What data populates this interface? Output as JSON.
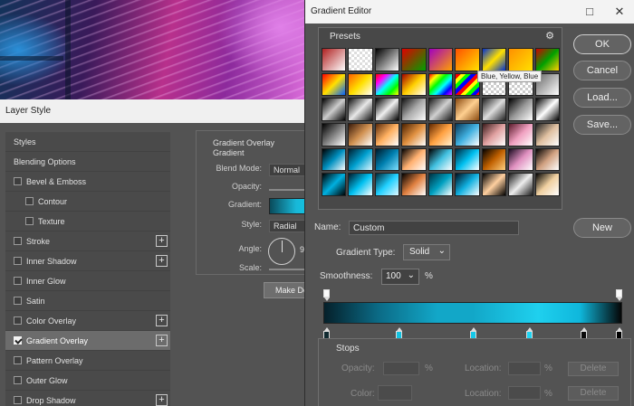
{
  "layer_style": {
    "title": "Layer Style",
    "items": [
      {
        "label": "Styles",
        "checkbox": false,
        "checked": false,
        "indent": false,
        "plus": false,
        "selected": false
      },
      {
        "label": "Blending Options",
        "checkbox": false,
        "checked": false,
        "indent": false,
        "plus": false,
        "selected": false
      },
      {
        "label": "Bevel & Emboss",
        "checkbox": true,
        "checked": false,
        "indent": false,
        "plus": false,
        "selected": false
      },
      {
        "label": "Contour",
        "checkbox": true,
        "checked": false,
        "indent": true,
        "plus": false,
        "selected": false
      },
      {
        "label": "Texture",
        "checkbox": true,
        "checked": false,
        "indent": true,
        "plus": false,
        "selected": false
      },
      {
        "label": "Stroke",
        "checkbox": true,
        "checked": false,
        "indent": false,
        "plus": true,
        "selected": false
      },
      {
        "label": "Inner Shadow",
        "checkbox": true,
        "checked": false,
        "indent": false,
        "plus": true,
        "selected": false
      },
      {
        "label": "Inner Glow",
        "checkbox": true,
        "checked": false,
        "indent": false,
        "plus": false,
        "selected": false
      },
      {
        "label": "Satin",
        "checkbox": true,
        "checked": false,
        "indent": false,
        "plus": false,
        "selected": false
      },
      {
        "label": "Color Overlay",
        "checkbox": true,
        "checked": false,
        "indent": false,
        "plus": true,
        "selected": false
      },
      {
        "label": "Gradient Overlay",
        "checkbox": true,
        "checked": true,
        "indent": false,
        "plus": true,
        "selected": true
      },
      {
        "label": "Pattern Overlay",
        "checkbox": true,
        "checked": false,
        "indent": false,
        "plus": false,
        "selected": false
      },
      {
        "label": "Outer Glow",
        "checkbox": true,
        "checked": false,
        "indent": false,
        "plus": false,
        "selected": false
      },
      {
        "label": "Drop Shadow",
        "checkbox": true,
        "checked": false,
        "indent": false,
        "plus": true,
        "selected": false
      }
    ],
    "panel": {
      "title": "Gradient Overlay",
      "subtitle": "Gradient",
      "blend_mode_label": "Blend Mode:",
      "blend_mode_value": "Normal",
      "opacity_label": "Opacity:",
      "gradient_label": "Gradient:",
      "style_label": "Style:",
      "style_value": "Radial",
      "angle_label": "Angle:",
      "angle_value": "9",
      "scale_label": "Scale:",
      "make_default_label": "Make De"
    }
  },
  "gradient_editor": {
    "title": "Gradient Editor",
    "window_buttons": {
      "minimize": "□",
      "close": "✕"
    },
    "presets": {
      "title": "Presets",
      "gear_icon": "⚙",
      "tooltip": "Blue, Yellow, Blue",
      "swatches": [
        "linear-gradient(135deg,#b02020,#fff)",
        "repeating-conic-gradient(#ddd 0 25%,#fff 0 50%) 0 0/6px 6px",
        "linear-gradient(135deg,#000,#fff)",
        "linear-gradient(135deg,#e00000,#00a000)",
        "linear-gradient(135deg,#a000c0,#ffa000)",
        "linear-gradient(135deg,#ff5000,#ffe000)",
        "linear-gradient(135deg,#0030d0,#ffe000,#0030d0)",
        "linear-gradient(135deg,#ff9000,#ffe000)",
        "linear-gradient(135deg,#d00000,#00a000,#ffd000)",
        "linear-gradient(135deg,#ff0000,#ffe000,#0060ff)",
        "linear-gradient(135deg,#ff6000,#ffe000,#fff)",
        "linear-gradient(135deg,#ff0000,#ff00ff,#00ffff,#00ff00,#ffff00)",
        "linear-gradient(135deg,#a00000,#ffd000,#fff)",
        "linear-gradient(135deg,#ff0000,#ffff00,#00ff00,#00ffff,#0000ff,#ff00ff)",
        "repeating-linear-gradient(135deg,#ff0000 0 4px,#ffff00 4px 8px,#00ff00 8px 12px,#0000ff 12px 16px)",
        "repeating-conic-gradient(#ccc 0 25%,#fff 0 50%) 0 0/6px 6px",
        "repeating-conic-gradient(#ccc 0 25%,#fff 0 50%) 0 0/6px 6px",
        "linear-gradient(135deg,#666,#fff)",
        "linear-gradient(135deg,#000,#ccc,#000)",
        "linear-gradient(135deg,#111,#e8e8e8,#111)",
        "linear-gradient(135deg,#000,#f0f0f0,#000)",
        "linear-gradient(135deg,#111,#aaa,#fff)",
        "linear-gradient(135deg,#1a1a1a,#d0d0d0,#1a1a1a)",
        "linear-gradient(135deg,#8a4a10,#ffd090,#8a4a10)",
        "linear-gradient(135deg,#222,#ddd,#222)",
        "linear-gradient(135deg,#000,#999,#fff)",
        "linear-gradient(135deg,#000,#fff,#000)",
        "linear-gradient(135deg,#000,#fff)",
        "linear-gradient(135deg,#3a1a0a,#d09050,#fff)",
        "linear-gradient(135deg,#5a2a0a,#ffb060,#fff)",
        "linear-gradient(135deg,#4a2000,#e09040,#fff)",
        "linear-gradient(135deg,#602800,#ffa040,#fff0d0)",
        "linear-gradient(135deg,#0a3a5a,#40b0e0,#fff)",
        "linear-gradient(135deg,#3a1a1a,#e0a0a0,#fff)",
        "linear-gradient(135deg,#5a1a2a,#f0a0c0,#fff)",
        "linear-gradient(135deg,#222,#e0c0a0,#fff)",
        "linear-gradient(135deg,#000,#0090c0,#fff)",
        "linear-gradient(135deg,#002030,#00a0d0,#e0f8ff)",
        "linear-gradient(135deg,#001a2a,#0080b0,#80e0ff)",
        "linear-gradient(135deg,#000,#ffb070,#fff)",
        "linear-gradient(135deg,#000,#40c0e0,#fff)",
        "linear-gradient(135deg,#002a40,#00c0f0,#fff)",
        "linear-gradient(135deg,#000,#c06000,#ffd080)",
        "linear-gradient(135deg,#1a0a20,#e090c0,#fff)",
        "linear-gradient(135deg,#000,#d0a080,#fff)",
        "linear-gradient(135deg,#000,#00b0e0,#000)",
        "linear-gradient(135deg,#001a2a,#00c0f0,#fff)",
        "linear-gradient(135deg,#002a3a,#20d0ff,#e0f8ff)",
        "linear-gradient(135deg,#000,#e08040,#fff)",
        "linear-gradient(135deg,#003040,#00a0c0,#fff)",
        "linear-gradient(135deg,#001020,#10b0e0,#fff)",
        "linear-gradient(135deg,#000,#ffd0a0,#000)",
        "linear-gradient(135deg,#1a1a1a,#eee,#1a1a1a)",
        "linear-gradient(135deg,#000,#f0d0a0,#fff)"
      ]
    },
    "buttons": {
      "ok": "OK",
      "cancel": "Cancel",
      "load": "Load...",
      "save": "Save...",
      "new": "New"
    },
    "name_label": "Name:",
    "name_value": "Custom",
    "gradient_type_label": "Gradient Type:",
    "gradient_type_value": "Solid",
    "smoothness_label": "Smoothness:",
    "smoothness_value": "100",
    "smoothness_unit": "%",
    "stops": {
      "title": "Stops",
      "opacity_label": "Opacity:",
      "opacity_unit": "%",
      "color_label": "Color:",
      "location_label": "Location:",
      "location_unit": "%",
      "delete_label": "Delete"
    },
    "color_stop_colors": [
      "#102a30",
      "#11c2e0",
      "#14c8e8",
      "#1ed4f2",
      "#0a0a0a",
      "#000000"
    ]
  }
}
